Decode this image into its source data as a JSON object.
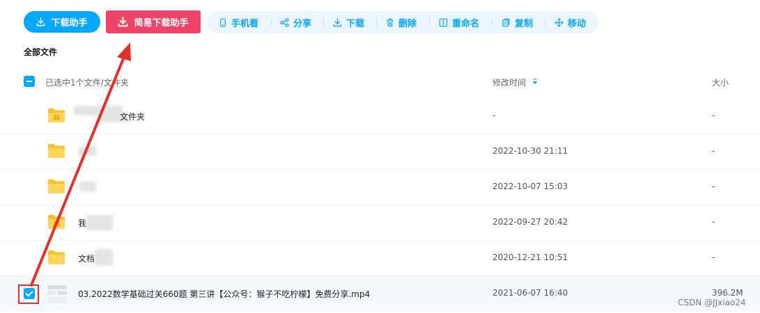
{
  "toolbar": {
    "download_helper": "下载助手",
    "easy_download_helper": "简易下载助手",
    "actions": {
      "mobile_view": "手机看",
      "share": "分享",
      "download": "下载",
      "delete": "删除",
      "rename": "重命名",
      "copy": "复制",
      "move": "移动"
    }
  },
  "breadcrumb": "全部文件",
  "table": {
    "selection_summary": "已选中1个文件/文件夹",
    "col_modified": "修改时间",
    "col_size": "大小",
    "rows": [
      {
        "name": "文件夹",
        "modified": "-",
        "size": "-"
      },
      {
        "name": "",
        "modified": "2022-10-30 21:11",
        "size": "-"
      },
      {
        "name": "",
        "modified": "2022-10-07 15:03",
        "size": "-"
      },
      {
        "name": "我",
        "modified": "2022-09-27 20:42",
        "size": "-"
      },
      {
        "name": "文档",
        "modified": "2020-12-21 10:51",
        "size": "-"
      },
      {
        "name": "03.2022数学基础过关660题 第三讲【公众号：猴子不吃柠檬】免费分享.mp4",
        "modified": "2021-06-07 16:40",
        "size": "396.2M"
      }
    ]
  },
  "watermark": "CSDN @JJxiao24",
  "colors": {
    "accent": "#06a7ff",
    "easy_button": "#ef4467",
    "annotation": "#e0322b"
  }
}
